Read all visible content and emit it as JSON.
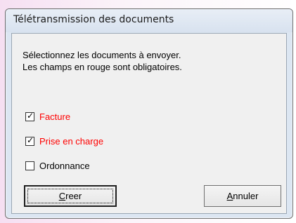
{
  "window": {
    "title": "Télétransmission des documents"
  },
  "dialog": {
    "instruction_line1": "Sélectionnez les documents à envoyer.",
    "instruction_line2": "Les champs en rouge sont obligatoires.",
    "documents": [
      {
        "label": "Facture",
        "checked": true,
        "required": true,
        "color": "#ff0000"
      },
      {
        "label": "Prise en charge",
        "checked": true,
        "required": true,
        "color": "#ff0000"
      },
      {
        "label": "Ordonnance",
        "checked": false,
        "required": false,
        "color": "#000000"
      }
    ],
    "buttons": {
      "create_label": "Creer",
      "cancel_label": "Annuler"
    }
  }
}
